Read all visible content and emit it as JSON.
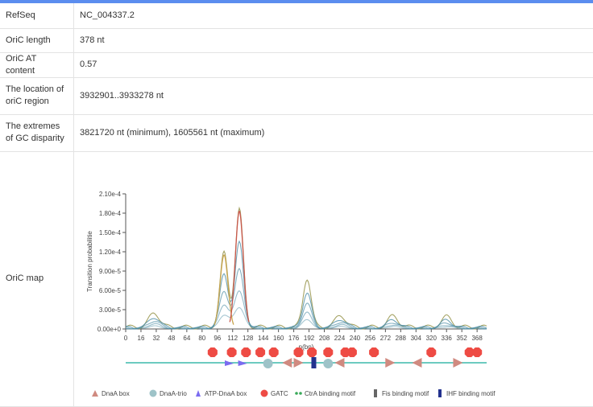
{
  "rows": [
    {
      "label": "RefSeq",
      "value": "NC_004337.2"
    },
    {
      "label": "OriC length",
      "value": "378 nt"
    },
    {
      "label": "OriC AT content",
      "value": "0.57"
    },
    {
      "label": "The location of oriC region",
      "value": "3932901..3933278 nt"
    },
    {
      "label": "The extremes of GC disparity",
      "value": "3821720 nt (minimum), 1605561 nt (maximum)"
    },
    {
      "label": "OriC map",
      "value": ""
    }
  ],
  "chart_data": {
    "type": "line",
    "ylabel": "Transition probabilitie",
    "xlabel": "n(bp)",
    "ylim": [
      0,
      0.00021
    ],
    "xlim": [
      0,
      378
    ],
    "yticks": [
      "0.00e+0",
      "3.00e-5",
      "6.00e-5",
      "9.00e-5",
      "1.20e-4",
      "1.50e-4",
      "1.80e-4",
      "2.10e-4"
    ],
    "xticks": [
      "0",
      "16",
      "32",
      "48",
      "64",
      "80",
      "96",
      "112",
      "128",
      "144",
      "160",
      "176",
      "192",
      "208",
      "224",
      "240",
      "256",
      "272",
      "288",
      "304",
      "320",
      "336",
      "352",
      "368"
    ],
    "peaks": [
      {
        "x": 30,
        "y": 2.2e-05
      },
      {
        "x": 103,
        "y": 0.000115
      },
      {
        "x": 119,
        "y": 0.000183
      },
      {
        "x": 190,
        "y": 7.6e-05
      },
      {
        "x": 225,
        "y": 1.8e-05
      },
      {
        "x": 280,
        "y": 1.7e-05
      },
      {
        "x": 336,
        "y": 1.6e-05
      }
    ],
    "features": {
      "GATC": [
        91,
        111,
        126,
        141,
        155,
        181,
        195,
        212,
        230,
        237,
        260,
        320,
        360,
        368
      ],
      "DnaA_trio": [
        149,
        212
      ],
      "DnaA_box_right": [
        181,
        277,
        348
      ],
      "DnaA_box_left": [
        169,
        224,
        305
      ],
      "ATP_DnaA_box": [
        108,
        122
      ],
      "IHF": [
        197
      ]
    },
    "legend": [
      "DnaA box",
      "DnaA-trio",
      "ATP-DnaA box",
      "GATC",
      "CtrA binding motif",
      "Fis binding motif",
      "IHF binding motif"
    ]
  },
  "colors": {
    "gatc": "#ee4b44",
    "trio": "#9ec3c8",
    "dnaa": "#d08a80",
    "atp": "#7b6cf0",
    "ihf": "#23328e",
    "baseline": "#6ccac0",
    "curve": "#4f8fa6"
  }
}
